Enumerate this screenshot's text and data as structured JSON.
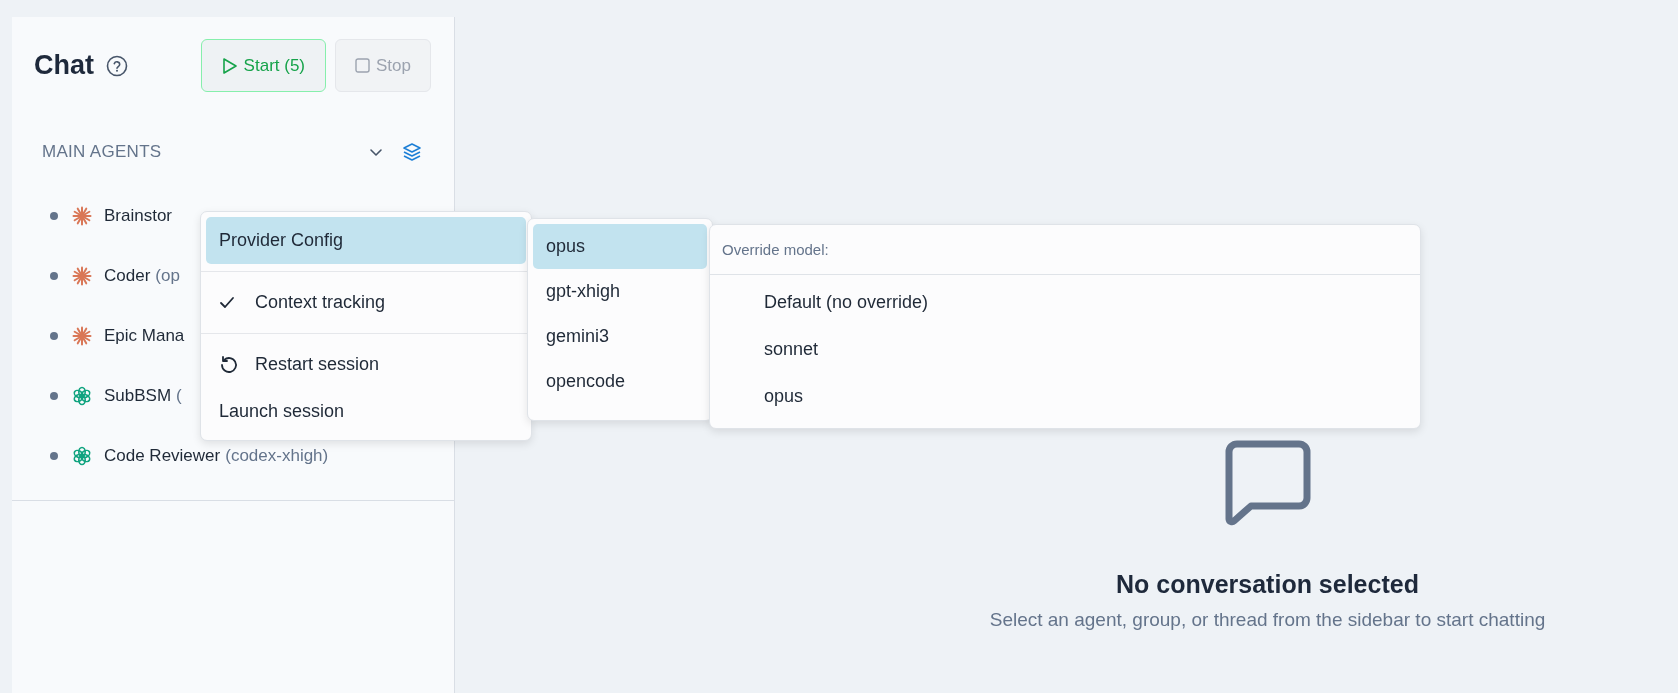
{
  "sidebar": {
    "title": "Chat",
    "start_button": "Start (5)",
    "stop_button": "Stop",
    "stop_disabled": true,
    "section": {
      "title": "MAIN AGENTS",
      "expanded": true,
      "agents": [
        {
          "kind": "starburst",
          "name": "Brainstor"
        },
        {
          "kind": "starburst",
          "name": "Coder",
          "model": "(op"
        },
        {
          "kind": "starburst",
          "name": "Epic Mana"
        },
        {
          "kind": "knot",
          "name": "SubBSM",
          "model": "("
        },
        {
          "kind": "knot",
          "name": "Code Reviewer",
          "model": "(codex-xhigh)"
        }
      ]
    }
  },
  "context_menu": {
    "items": [
      {
        "kind": "submenu",
        "label": "Provider Config",
        "selected": true
      },
      {
        "kind": "toggle",
        "label": "Context tracking",
        "checked": true
      },
      {
        "kind": "restart",
        "label": "Restart session"
      },
      {
        "kind": "plain",
        "label": "Launch session"
      }
    ]
  },
  "provider_menu": {
    "items": [
      {
        "label": "opus",
        "selected": true
      },
      {
        "label": "gpt-xhigh",
        "selected": false
      },
      {
        "label": "gemini3",
        "selected": false
      },
      {
        "label": "opencode",
        "selected": false
      }
    ]
  },
  "model_menu": {
    "header": "Override model:",
    "options": [
      "Default (no override)",
      "sonnet",
      "opus"
    ]
  },
  "empty_state": {
    "title": "No conversation selected",
    "subtitle": "Select an agent, group, or thread from the sidebar to start chatting"
  }
}
